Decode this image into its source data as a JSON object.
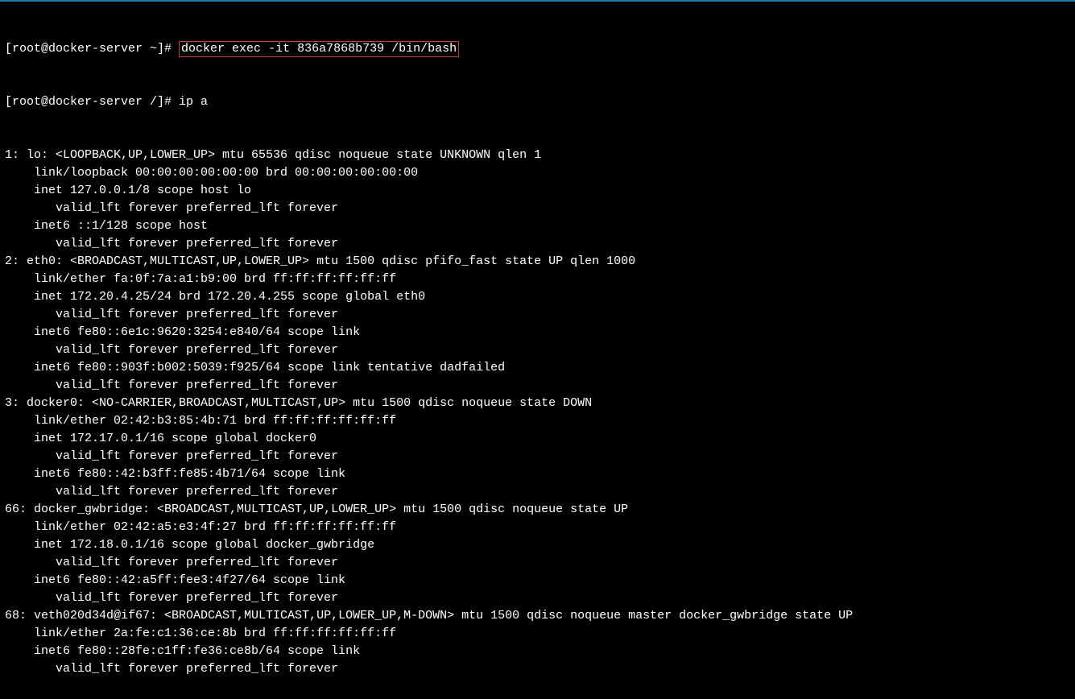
{
  "terminal": {
    "prompt1_prefix": "[root@docker-server ~]# ",
    "cmd1": "docker exec -it 836a7868b739 /bin/bash",
    "prompt2_prefix": "[root@docker-server /]# ",
    "cmd2": "ip a",
    "interfaces": [
      {
        "header": "1: lo: <LOOPBACK,UP,LOWER_UP> mtu 65536 qdisc noqueue state UNKNOWN qlen 1",
        "lines": [
          "link/loopback 00:00:00:00:00:00 brd 00:00:00:00:00:00",
          "inet 127.0.0.1/8 scope host lo",
          "   valid_lft forever preferred_lft forever",
          "inet6 ::1/128 scope host ",
          "   valid_lft forever preferred_lft forever"
        ]
      },
      {
        "header": "2: eth0: <BROADCAST,MULTICAST,UP,LOWER_UP> mtu 1500 qdisc pfifo_fast state UP qlen 1000",
        "lines": [
          "link/ether fa:0f:7a:a1:b9:00 brd ff:ff:ff:ff:ff:ff",
          "inet 172.20.4.25/24 brd 172.20.4.255 scope global eth0",
          "   valid_lft forever preferred_lft forever",
          "inet6 fe80::6e1c:9620:3254:e840/64 scope link ",
          "   valid_lft forever preferred_lft forever",
          "inet6 fe80::903f:b002:5039:f925/64 scope link tentative dadfailed ",
          "   valid_lft forever preferred_lft forever"
        ]
      },
      {
        "header": "3: docker0: <NO-CARRIER,BROADCAST,MULTICAST,UP> mtu 1500 qdisc noqueue state DOWN ",
        "lines": [
          "link/ether 02:42:b3:85:4b:71 brd ff:ff:ff:ff:ff:ff",
          "inet 172.17.0.1/16 scope global docker0",
          "   valid_lft forever preferred_lft forever",
          "inet6 fe80::42:b3ff:fe85:4b71/64 scope link ",
          "   valid_lft forever preferred_lft forever"
        ]
      },
      {
        "header": "66: docker_gwbridge: <BROADCAST,MULTICAST,UP,LOWER_UP> mtu 1500 qdisc noqueue state UP ",
        "lines": [
          "link/ether 02:42:a5:e3:4f:27 brd ff:ff:ff:ff:ff:ff",
          "inet 172.18.0.1/16 scope global docker_gwbridge",
          "   valid_lft forever preferred_lft forever",
          "inet6 fe80::42:a5ff:fee3:4f27/64 scope link ",
          "   valid_lft forever preferred_lft forever"
        ]
      },
      {
        "header": "68: veth020d34d@if67: <BROADCAST,MULTICAST,UP,LOWER_UP,M-DOWN> mtu 1500 qdisc noqueue master docker_gwbridge state UP ",
        "lines": [
          "link/ether 2a:fe:c1:36:ce:8b brd ff:ff:ff:ff:ff:ff",
          "inet6 fe80::28fe:c1ff:fe36:ce8b/64 scope link ",
          "   valid_lft forever preferred_lft forever"
        ]
      }
    ]
  }
}
